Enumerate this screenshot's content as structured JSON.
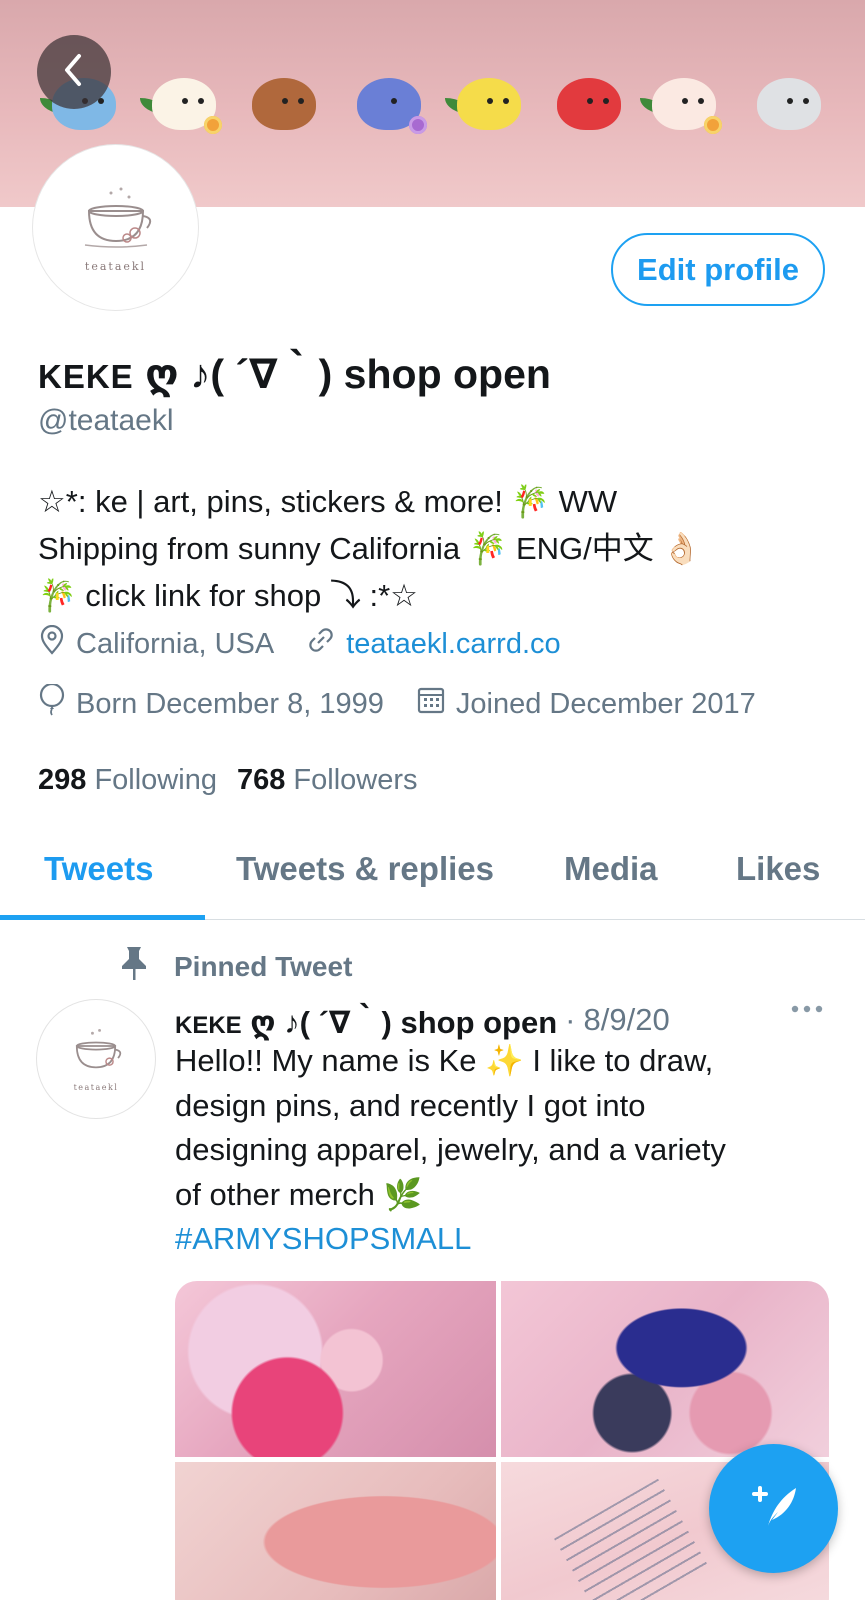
{
  "profile": {
    "name_prefix": "KEKE",
    "name_rest": " ღ ♪( ´∇｀) shop open",
    "handle": "@teataekl",
    "avatar_text": "teataekl",
    "edit_label": "Edit profile",
    "bio_lines": [
      "☆*: ke | art, pins, stickers & more! 🎋 WW",
      "Shipping from sunny California 🎋 ENG/中文 👌🏻",
      "🎋 click link for shop ⤵ :*☆"
    ],
    "location": "California, USA",
    "website": "teataekl.carrd.co",
    "birthday": "Born December 8, 1999",
    "joined": "Joined December 2017",
    "following_count": "298",
    "following_label": "Following",
    "followers_count": "768",
    "followers_label": "Followers"
  },
  "tabs": [
    {
      "label": "Tweets"
    },
    {
      "label": "Tweets & replies"
    },
    {
      "label": "Media"
    },
    {
      "label": "Likes"
    }
  ],
  "pinned_tweet": {
    "pinned_label": "Pinned Tweet",
    "author_prefix": "KEKE",
    "author_rest": " ღ ♪( ´∇｀) shop open",
    "separator": "·",
    "date": "8/9/20",
    "text_lines": [
      "Hello!! My name is Ke ✨ I like to draw,",
      "design pins, and recently I got into",
      "designing apparel, jewelry, and a variety",
      "of other merch 🌿"
    ],
    "hashtag": "#ARMYSHOPSMALL"
  },
  "colors": {
    "accent": "#1da1f2",
    "secondary_text": "#657786",
    "banner": "#e8b9bc"
  },
  "icons": {
    "back": "chevron-left-icon",
    "location": "location-pin-icon",
    "link": "link-icon",
    "birthday": "balloon-icon",
    "calendar": "calendar-icon",
    "pin": "pushpin-icon",
    "more": "more-horizontal-icon",
    "compose": "compose-tweet-icon"
  }
}
